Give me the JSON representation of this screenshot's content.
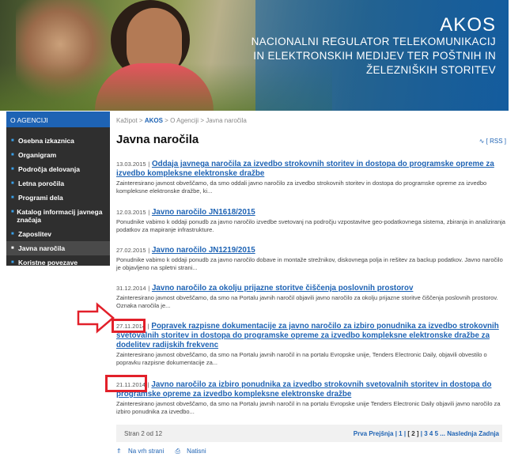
{
  "brand": {
    "name": "AKOS",
    "tagline": "NACIONALNI REGULATOR TELEKOMUNIKACIJ IN ELEKTRONSKIH MEDIJEV TER POŠTNIH IN ŽELEZNIŠKIH STORITEV"
  },
  "sidebar": {
    "header": "O AGENCIJI",
    "items": [
      {
        "label": "Osebna izkaznica"
      },
      {
        "label": "Organigram"
      },
      {
        "label": "Področja delovanja"
      },
      {
        "label": "Letna poročila"
      },
      {
        "label": "Programi dela"
      },
      {
        "label": "Katalog informacij javnega značaja"
      },
      {
        "label": "Zaposlitev"
      },
      {
        "label": "Javna naročila"
      },
      {
        "label": "Koristne povezave"
      }
    ]
  },
  "breadcrumb": {
    "root": "Kažipot",
    "akos": "AKOS",
    "section": "O Agenciji",
    "current": "Javna naročila"
  },
  "page_title": "Javna naročila",
  "rss": "[ RSS ]",
  "items": [
    {
      "date": "13.03.2015",
      "title": "Oddaja javnega naročila za izvedbo strokovnih storitev in dostopa do programske opreme za izvedbo kompleksne elektronske dražbe",
      "excerpt": "Zainteresirano javnost obveščamo, da smo oddali javno naročilo za izvedbo strokovnih storitev in dostopa do programske opreme za izvedbo kompleksne elektronske dražbe, ki..."
    },
    {
      "date": "12.03.2015",
      "title": "Javno naročilo JN1618/2015",
      "excerpt": "Ponudnike vabimo k oddaji ponudb za javno naročilo izvedbe svetovanj na področju vzpostavitve geo-podatkovnega sistema, zbiranja in analiziranja podatkov za mapiranje infrastrukture."
    },
    {
      "date": "27.02.2015",
      "title": "Javno naročilo JN1219/2015",
      "excerpt": "Ponudnike vabimo k oddaji ponudb za javno naročilo dobave in montaže strežnikov, diskovnega polja in rešitev za backup podatkov. Javno naročilo je objavljeno na spletni strani..."
    },
    {
      "date": "31.12.2014",
      "title": "Javno naročilo za okolju prijazne storitve čiščenja poslovnih prostorov",
      "excerpt": "Zainteresirano javnost obveščamo, da smo na Portalu javnih naročil objavili javno naročilo za okolju prijazne storitve čiščenja poslovnih prostorov. Oznaka naročila je..."
    },
    {
      "date": "27.11.2014",
      "title": "Popravek razpisne dokumentacije za javno naročilo za izbiro ponudnika za izvedbo strokovnih svetovalnih storitev in dostopa do programske opreme za izvedbo kompleksne elektronske dražbe za dodelitev radijskih frekvenc",
      "excerpt": "Zainteresirano javnost obveščamo, da smo na Portalu javnih naročil in na portalu Evropske unije, Tenders Electronic Daily, objavili obvestilo o popravku razpisne dokumentacije za..."
    },
    {
      "date": "21.11.2014",
      "title": "Javno naročilo za izbiro ponudnika za izvedbo strokovnih svetovalnih storitev in dostopa do programske opreme za izvedbo kompleksne elektronske dražbe",
      "excerpt": "Zainteresirano javnost obveščamo, da smo na Portalu javnih naročil in na portalu Evropske unije Tenders Electronic Daily objavili javno naročilo za izbiro ponudnika za izvedbo..."
    }
  ],
  "pager": {
    "status": "Stran 2 od 12",
    "first": "Prva",
    "prev": "Prejšnja",
    "pages_before": "| 1 |",
    "current": "2",
    "pages_after": "| 3 4 5 ...",
    "next": "Naslednja",
    "last": "Zadnja"
  },
  "footer": {
    "top": "Na vrh strani",
    "print": "Natisni"
  },
  "colors": {
    "accent": "#1e63b4",
    "highlight": "#e2202a",
    "sidebar_bg": "#2f2f2f"
  }
}
